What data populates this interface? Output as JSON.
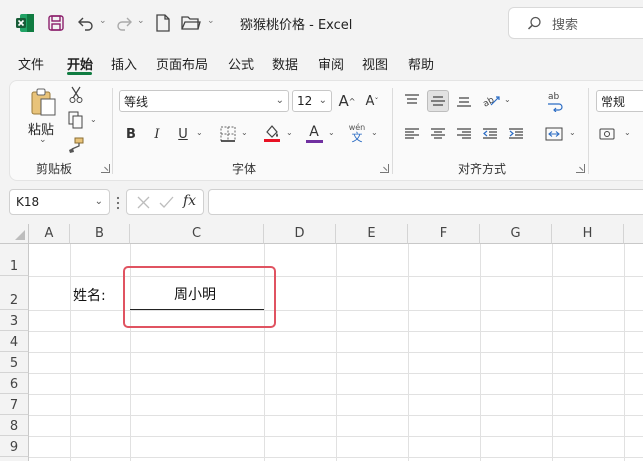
{
  "title_bar": {
    "doc_title": "猕猴桃价格 - Excel",
    "search_label": "搜索"
  },
  "menu": {
    "items": [
      "文件",
      "开始",
      "插入",
      "页面布局",
      "公式",
      "数据",
      "审阅",
      "视图",
      "帮助"
    ],
    "active_index": 1
  },
  "ribbon": {
    "clipboard": {
      "paste_label": "粘贴",
      "group_label": "剪贴板"
    },
    "font": {
      "font_name": "等线",
      "font_size": "12",
      "bold": "B",
      "italic": "I",
      "underline": "U",
      "font_color": "A",
      "font_color_hex": "#7030a0",
      "fill_color_hex": "#e81123",
      "pinyin_top": "wén",
      "pinyin_bottom": "文",
      "grow": "A",
      "shrink": "A",
      "group_label": "字体"
    },
    "alignment": {
      "group_label": "对齐方式"
    },
    "number": {
      "format": "常规"
    }
  },
  "formula_bar": {
    "name_box": "K18",
    "fx_label": "fx",
    "formula": ""
  },
  "sheet": {
    "columns": [
      "A",
      "B",
      "C",
      "D",
      "E",
      "F",
      "G",
      "H"
    ],
    "rows": [
      "1",
      "2",
      "3",
      "4",
      "5",
      "6",
      "7",
      "8",
      "9"
    ],
    "b2": "姓名:",
    "c2": "周小明"
  },
  "colors": {
    "accent": "#107c41",
    "highlight_border": "#e05361"
  }
}
